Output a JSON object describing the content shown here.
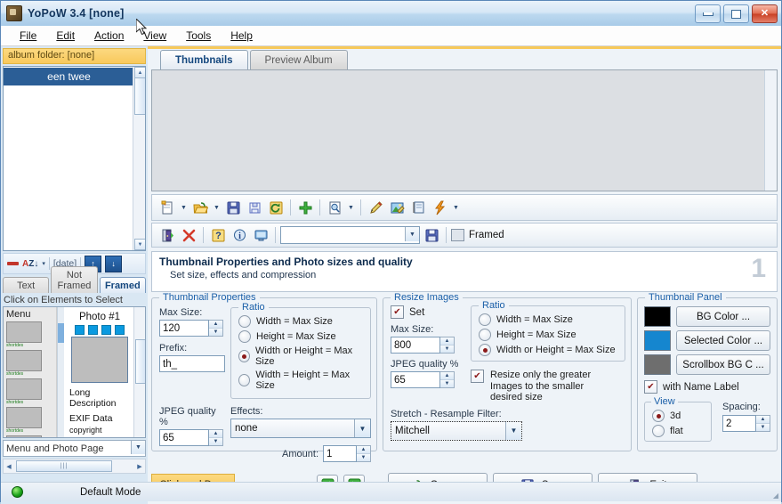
{
  "window": {
    "title": "YoPoW 3.4 [none]",
    "icon": "app-icon",
    "controls": {
      "minimize": "minimize",
      "maximize": "maximize",
      "close": "close"
    }
  },
  "menu": {
    "items": [
      "File",
      "Edit",
      "Action",
      "View",
      "Tools",
      "Help"
    ]
  },
  "sidebar": {
    "album_folder_bar": "album folder: [none]",
    "album_items": [
      "een twee"
    ],
    "tools": {
      "remove": "remove",
      "sort": "sort-az",
      "sort_caret": "▾",
      "date": "[date]",
      "move_up": "↑",
      "move_down": "↓"
    },
    "tabs": [
      {
        "label": "Text",
        "active": false
      },
      {
        "label": "Not Framed",
        "active": false
      },
      {
        "label": "Framed",
        "active": true
      }
    ],
    "hint": "Click on Elements to Select",
    "preview": {
      "menu_label": "Menu",
      "shortdes_caption": "shortdes",
      "photo_title": "Photo #1",
      "long_description": "Long Description",
      "exif": "EXIF Data",
      "copyright": "copyright"
    },
    "page_select": "Menu and Photo Page"
  },
  "main": {
    "tabs": [
      {
        "label": "Thumbnails",
        "active": true
      },
      {
        "label": "Preview Album",
        "active": false
      }
    ],
    "toolbar1": [
      {
        "name": "new-document-icon",
        "glyph": "new"
      },
      {
        "name": "new-document-dropdown",
        "glyph": "caret"
      },
      {
        "name": "open-folder-icon",
        "glyph": "folder"
      },
      {
        "name": "open-folder-dropdown",
        "glyph": "caret"
      },
      {
        "name": "save-icon",
        "glyph": "save"
      },
      {
        "name": "save-as-icon",
        "glyph": "saveas"
      },
      {
        "name": "refresh-icon",
        "glyph": "refresh"
      },
      {
        "name": "add-icon",
        "glyph": "plus"
      },
      {
        "name": "preview-page-icon",
        "glyph": "preview"
      },
      {
        "name": "preview-dropdown",
        "glyph": "caret"
      },
      {
        "name": "edit-pencil-icon",
        "glyph": "pencil"
      },
      {
        "name": "edit-image-icon",
        "glyph": "imageedit"
      },
      {
        "name": "page-icon",
        "glyph": "page"
      },
      {
        "name": "quick-action-icon",
        "glyph": "lightning"
      },
      {
        "name": "quick-action-dropdown",
        "glyph": "caret"
      }
    ],
    "toolbar2": {
      "exit": "exit-door-icon",
      "delete": "delete-x-icon",
      "help": "help-icon",
      "info": "info-icon",
      "monitor": "monitor-icon",
      "combo_value": "",
      "save": "save-icon",
      "framed_label": "Framed"
    },
    "header": {
      "title": "Thumbnail Properties and Photo sizes and quality",
      "subtitle": "Set size, effects and compression",
      "step": "1"
    },
    "thumbnail_properties": {
      "legend": "Thumbnail Properties",
      "max_size_label": "Max Size:",
      "max_size_value": "120",
      "prefix_label": "Prefix:",
      "prefix_value": "th_",
      "jpeg_label": "JPEG quality  %",
      "jpeg_value": "65",
      "ratio_legend": "Ratio",
      "ratio_options": [
        {
          "label": "Width = Max Size",
          "selected": false
        },
        {
          "label": "Height = Max Size",
          "selected": false
        },
        {
          "label": "Width or Height = Max Size",
          "selected": true
        },
        {
          "label": "Width = Height = Max Size",
          "selected": false
        }
      ],
      "effects_label": "Effects:",
      "effects_value": "none",
      "amount_label": "Amount:",
      "amount_value": "1"
    },
    "resize_images": {
      "legend": "Resize Images",
      "set_label": "Set",
      "set_checked": true,
      "max_size_label": "Max Size:",
      "max_size_value": "800",
      "jpeg_label": "JPEG quality %",
      "jpeg_value": "65",
      "ratio_legend": "Ratio",
      "ratio_options": [
        {
          "label": "Width = Max Size",
          "selected": false
        },
        {
          "label": "Height = Max Size",
          "selected": false
        },
        {
          "label": "Width or Height = Max Size",
          "selected": true
        }
      ],
      "filter_label": "Stretch - Resample Filter:",
      "filter_value": "Mitchell",
      "resize_only_greater": "Resize only the greater Images to the smaller desired size",
      "resize_only_greater_checked": true
    },
    "thumbnail_panel": {
      "legend": "Thumbnail Panel",
      "bg_color_label": "BG Color ...",
      "bg_color": "#000000",
      "selected_color_label": "Selected Color ...",
      "selected_color": "#1586cf",
      "scrollbox_label": "Scrollbox BG C ...",
      "scrollbox_color": "#6e6e6e",
      "name_label_text": "with Name Label",
      "name_label_checked": true,
      "view_legend": "View",
      "view_options": [
        {
          "label": "3d",
          "selected": true
        },
        {
          "label": "flat",
          "selected": false
        }
      ],
      "spacing_label": "Spacing:",
      "spacing_value": "2"
    },
    "bottom": {
      "click_and_drag": "Click and Drag",
      "back": "←",
      "forward": "→",
      "open_label": "Open ...",
      "save_label": "Save",
      "exit_label": "Exit"
    }
  },
  "statusbar": {
    "indicator": "status-green",
    "text": "Default Mode"
  }
}
